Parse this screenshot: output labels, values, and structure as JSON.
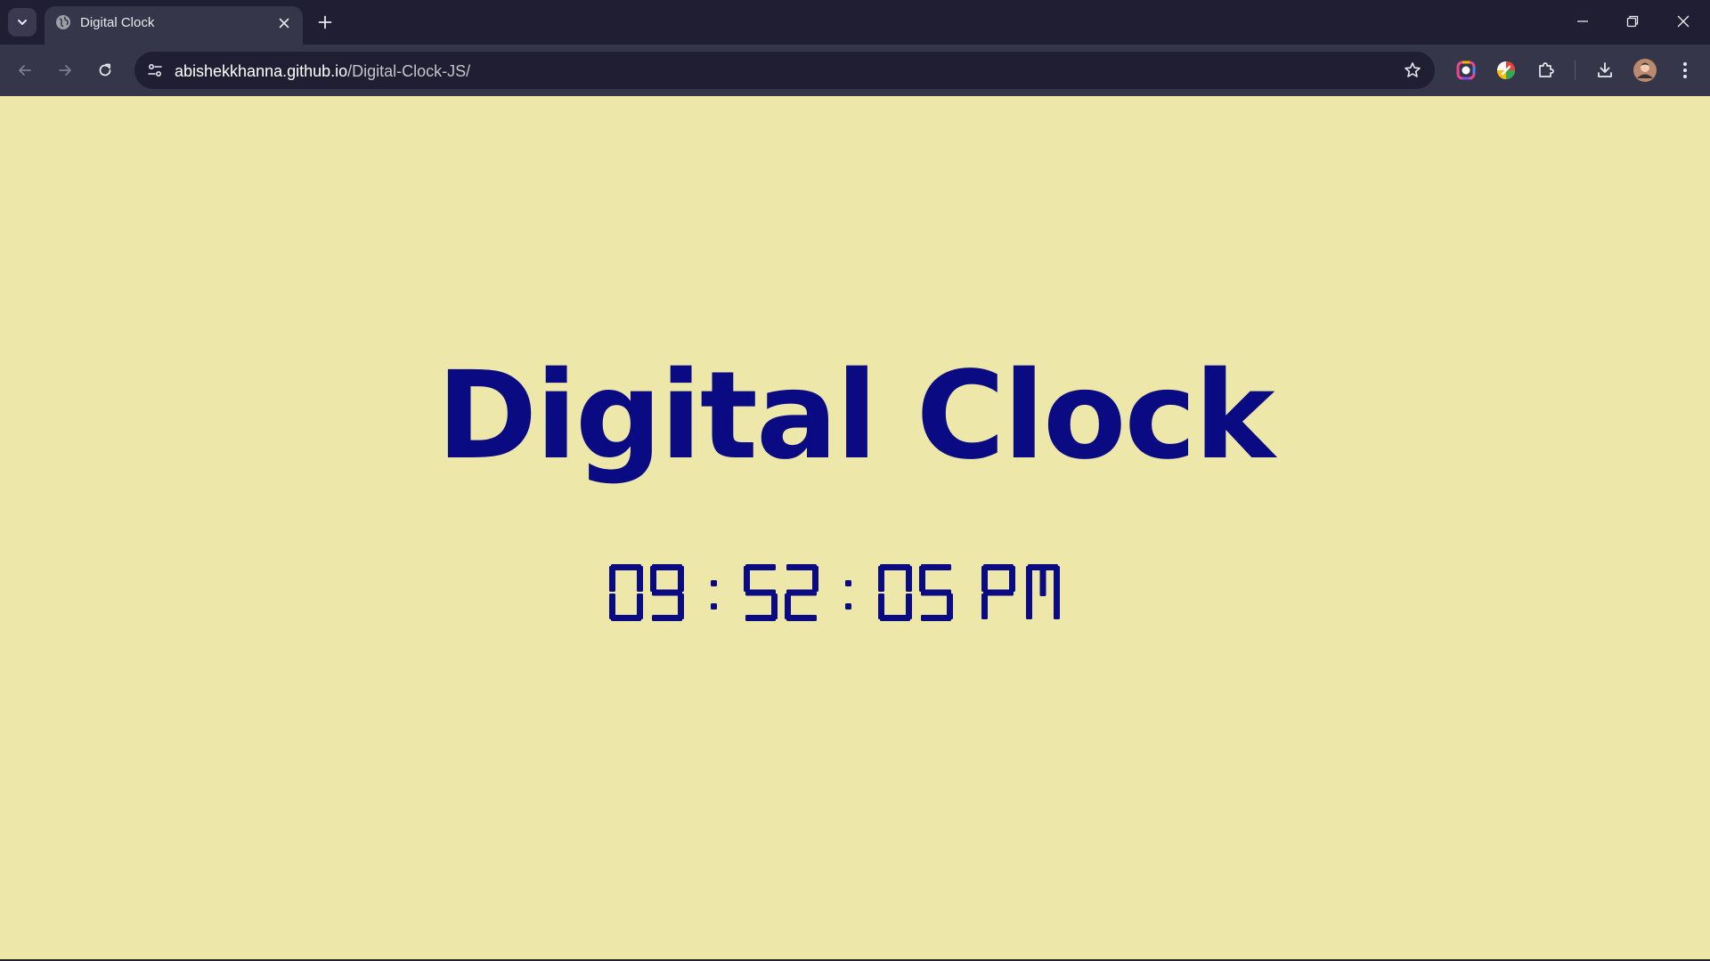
{
  "browser": {
    "tab": {
      "title": "Digital Clock"
    },
    "address_bar": {
      "host": "abishekkhanna.github.io",
      "path": "/Digital-Clock-JS/"
    },
    "icons": {
      "tab_search": "chevron-down-icon",
      "favicon": "globe-icon",
      "tab_close": "close-icon",
      "new_tab": "plus-icon",
      "minimize": "minimize-icon",
      "restore": "restore-icon",
      "close_window": "close-icon",
      "back": "arrow-left-icon",
      "forward": "arrow-right-icon",
      "reload": "reload-icon",
      "site_info": "tune-icon",
      "bookmark": "star-icon",
      "extension_1": "color-ring-icon",
      "extension_2": "color-pick-icon",
      "extensions": "puzzle-icon",
      "downloads": "download-icon",
      "profile": "avatar",
      "menu": "kebab-menu-icon"
    }
  },
  "page": {
    "heading": "Digital Clock",
    "clock": {
      "hours": "09",
      "minutes": "52",
      "seconds": "05",
      "period": "PM",
      "separator": ":"
    },
    "colors": {
      "background": "#ede7aa",
      "text": "#0a0a82"
    }
  }
}
